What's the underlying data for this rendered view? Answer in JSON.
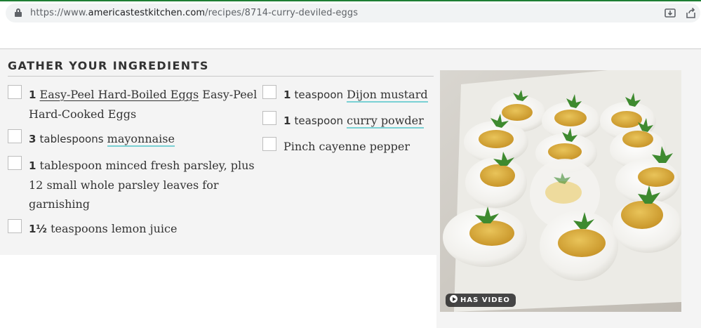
{
  "browser": {
    "url_scheme": "https://www.",
    "url_host": "americastestkitchen.com",
    "url_path": "/recipes/8714-curry-deviled-eggs"
  },
  "section": {
    "title": "GATHER YOUR INGREDIENTS"
  },
  "ingredients": [
    {
      "qty": "1",
      "link": "Easy-Peel Hard-Boiled Eggs",
      "line1_rest": " Easy-Peel",
      "line2": "Hard-Cooked Eggs"
    },
    {
      "qty": "3",
      "unit": "tablespoons",
      "link": "mayonnaise"
    },
    {
      "qty": "1",
      "line1": "tablespoon minced fresh parsley, plus",
      "line2": "12 small whole parsley leaves for",
      "line3": "garnishing"
    },
    {
      "qty": "1½",
      "line1": "teaspoons lemon juice"
    },
    {
      "qty": "1",
      "unit": "teaspoon",
      "link": "Dijon mustard"
    },
    {
      "qty": "1",
      "unit": "teaspoon",
      "link": "curry powder"
    },
    {
      "line1": "Pinch cayenne pepper"
    }
  ],
  "media": {
    "badge": "HAS VIDEO",
    "icon": "play-icon"
  }
}
